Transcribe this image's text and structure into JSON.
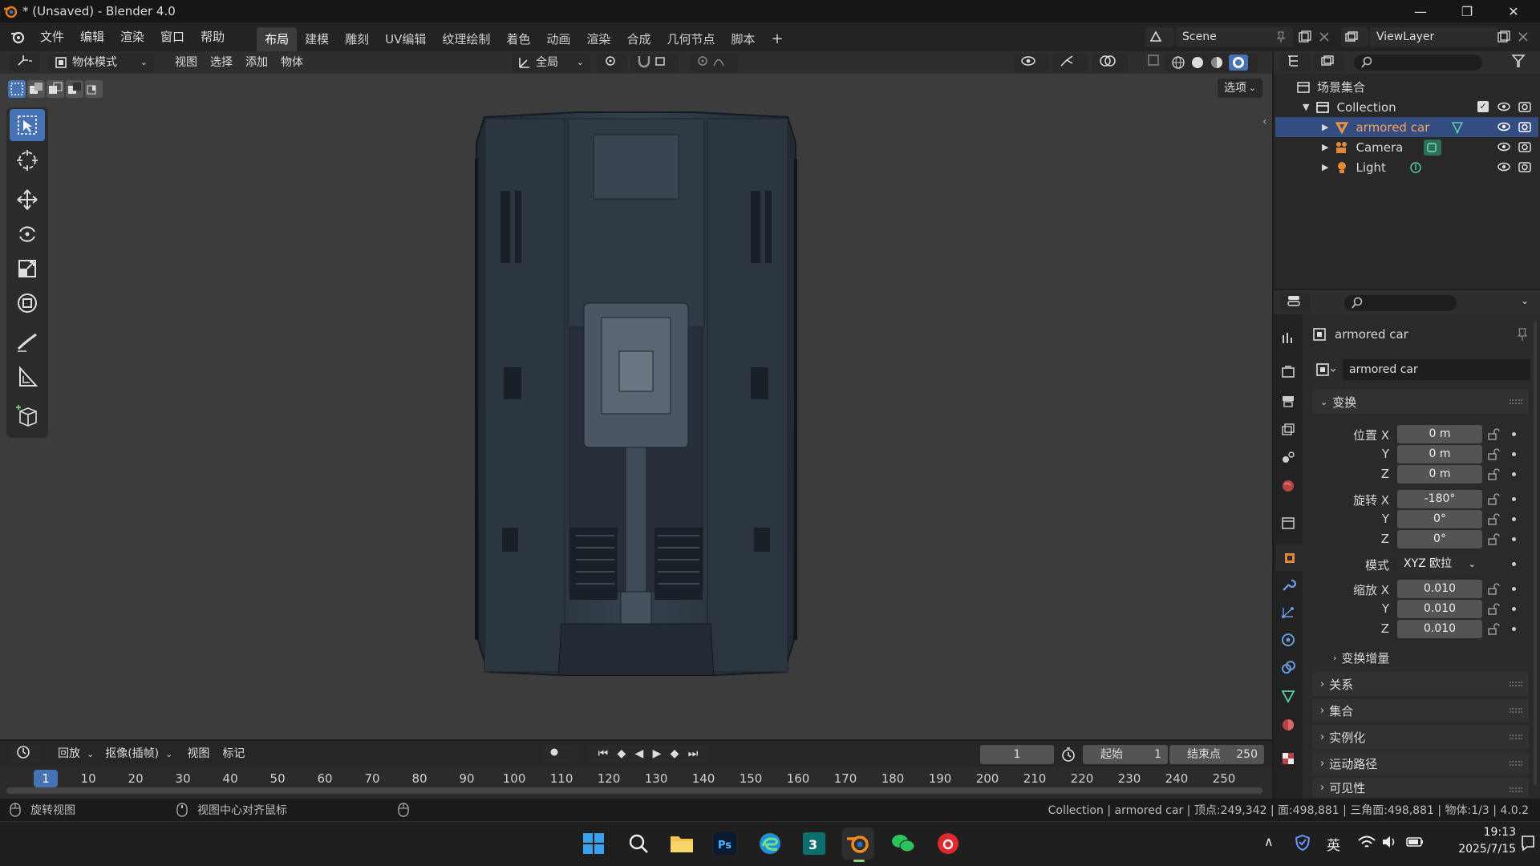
{
  "window": {
    "title": "* (Unsaved) - Blender 4.0"
  },
  "menu": {
    "items": [
      "文件",
      "编辑",
      "渲染",
      "窗口",
      "帮助"
    ]
  },
  "workspaces": {
    "tabs": [
      "布局",
      "建模",
      "雕刻",
      "UV编辑",
      "纹理绘制",
      "着色",
      "动画",
      "渲染",
      "合成",
      "几何节点",
      "脚本"
    ],
    "active": "布局",
    "add": "+"
  },
  "scene": {
    "name": "Scene",
    "view_layer": "ViewLayer"
  },
  "viewport_header": {
    "mode": "物体模式",
    "menus": [
      "视图",
      "选择",
      "添加",
      "物体"
    ],
    "orientation": "全局",
    "options": "选项"
  },
  "outliner": {
    "root": "场景集合",
    "collection": "Collection",
    "items": [
      {
        "name": "armored car",
        "selected": true,
        "icon": "mesh-icon"
      },
      {
        "name": "Camera",
        "selected": false,
        "icon": "camera-icon"
      },
      {
        "name": "Light",
        "selected": false,
        "icon": "light-icon"
      }
    ]
  },
  "properties": {
    "object_name": "armored car",
    "data_name": "armored car",
    "transform_title": "变换",
    "location": {
      "label": "位置 X",
      "x": "0 m",
      "y": "0 m",
      "z": "0 m"
    },
    "rotation": {
      "label": "旋转 X",
      "x": "-180°",
      "y": "0°",
      "z": "0°"
    },
    "mode_label": "模式",
    "mode_value": "XYZ 欧拉",
    "scale": {
      "label": "缩放 X",
      "x": "0.010",
      "y": "0.010",
      "z": "0.010"
    },
    "axis_y": "Y",
    "axis_z": "Z",
    "delta": "变换增量",
    "sections": [
      "关系",
      "集合",
      "实例化",
      "运动路径",
      "可见性"
    ]
  },
  "timeline": {
    "menus": [
      "回放",
      "抠像(插帧)",
      "视图",
      "标记"
    ],
    "current_frame": "1",
    "start_label": "起始",
    "start": "1",
    "end_label": "结束点",
    "end": "250",
    "ticks": [
      "1",
      "10",
      "20",
      "30",
      "40",
      "50",
      "60",
      "70",
      "80",
      "90",
      "100",
      "110",
      "120",
      "130",
      "140",
      "150",
      "160",
      "170",
      "180",
      "190",
      "200",
      "210",
      "220",
      "230",
      "240",
      "250"
    ]
  },
  "statusbar": {
    "left1": "旋转视图",
    "left2": "视图中心对齐鼠标",
    "right": "Collection | armored car | 顶点:249,342 | 面:498,881 | 三角面:498,881 | 物体:1/3 | 4.0.2"
  },
  "taskbar": {
    "ime": "英",
    "time": "19:13",
    "date": "2025/7/15"
  },
  "colors": {
    "accent": "#4772b3",
    "selected_text": "#f6a25b",
    "bg": "#3c3c3c"
  }
}
